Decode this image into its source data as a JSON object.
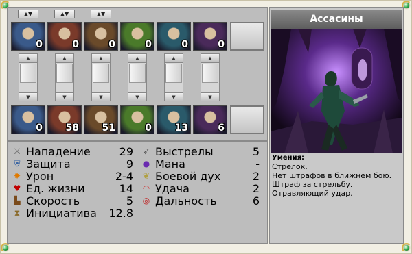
{
  "creature": {
    "name": "Ассасины"
  },
  "top_row": [
    {
      "count": "0",
      "icon": "dark-assassin-portrait",
      "bg": "#3a5a8a"
    },
    {
      "count": "0",
      "icon": "red-haired-elf-portrait",
      "bg": "#7a3a2a"
    },
    {
      "count": "0",
      "icon": "armored-beast-portrait",
      "bg": "#6a4a2a"
    },
    {
      "count": "0",
      "icon": "green-dragon-portrait",
      "bg": "#4a7a2a"
    },
    {
      "count": "0",
      "icon": "blue-green-dragon-portrait",
      "bg": "#2a5a6a"
    },
    {
      "count": "0",
      "icon": "sorceress-portrait",
      "bg": "#4a2a5a"
    }
  ],
  "bottom_row": [
    {
      "count": "0",
      "icon": "dark-assassin-portrait",
      "bg": "#3a5a8a"
    },
    {
      "count": "58",
      "icon": "red-haired-elf-portrait",
      "bg": "#7a3a2a"
    },
    {
      "count": "51",
      "icon": "armored-beast-portrait",
      "bg": "#6a4a2a"
    },
    {
      "count": "0",
      "icon": "green-dragon-portrait",
      "bg": "#4a7a2a"
    },
    {
      "count": "13",
      "icon": "blue-green-dragon-portrait",
      "bg": "#2a5a6a"
    },
    {
      "count": "6",
      "icon": "sorceress-portrait",
      "bg": "#4a2a5a"
    }
  ],
  "stats_left": [
    {
      "label": "Нападение",
      "value": "29",
      "icon": "crossed-swords-icon",
      "glyph": "⚔",
      "color": "#666"
    },
    {
      "label": "Защита",
      "value": "9",
      "icon": "shield-icon",
      "glyph": "⛨",
      "color": "#2a5aa0"
    },
    {
      "label": "Урон",
      "value": "2-4",
      "icon": "burst-icon",
      "glyph": "✸",
      "color": "#e07a00"
    },
    {
      "label": "Ед. жизни",
      "value": "14",
      "icon": "heart-icon",
      "glyph": "♥",
      "color": "#c00000"
    },
    {
      "label": "Скорость",
      "value": "5",
      "icon": "boot-icon",
      "glyph": "▙",
      "color": "#7a4a1a"
    },
    {
      "label": "Инициатива",
      "value": "12.8",
      "icon": "hourglass-icon",
      "glyph": "⧗",
      "color": "#8a6a2a"
    }
  ],
  "stats_right": [
    {
      "label": "Выстрелы",
      "value": "5",
      "icon": "arrow-icon",
      "glyph": "➶",
      "color": "#555"
    },
    {
      "label": "Мана",
      "value": "-",
      "icon": "mana-orb-icon",
      "glyph": "●",
      "color": "#6a2ab0"
    },
    {
      "label": "Боевой дух",
      "value": "2",
      "icon": "wings-icon",
      "glyph": "❦",
      "color": "#b0a040"
    },
    {
      "label": "Удача",
      "value": "2",
      "icon": "rainbow-icon",
      "glyph": "◠",
      "color": "#d04040"
    },
    {
      "label": "Дальность",
      "value": "6",
      "icon": "target-icon",
      "glyph": "◎",
      "color": "#c02020"
    }
  ],
  "skills": {
    "label": "Умения:",
    "lines": [
      "Стрелок.",
      "Нет штрафов в ближнем бою.",
      "Штраф за стрельбу.",
      "Отравляющий удар."
    ]
  },
  "toolbar": {
    "sort_glyph": "▲▼"
  }
}
